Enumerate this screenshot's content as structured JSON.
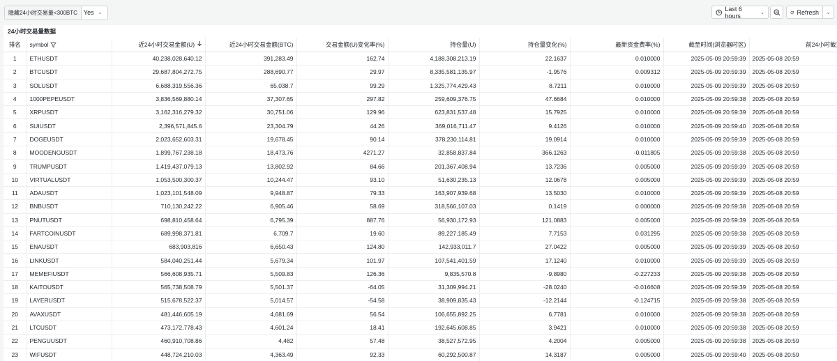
{
  "toolbar": {
    "filter_label": "隐藏24小时交易量<300BTC",
    "filter_value": "Yes",
    "time_range": "Last 6 hours",
    "refresh_label": "Refresh"
  },
  "panel": {
    "title": "24小时交易量数据",
    "columns": [
      "排名",
      "symbol",
      "近24小时交易金额(U)",
      "近24小时交易金额(BTC)",
      "交易金额(U)变化率(%)",
      "持仓量(U)",
      "持仓量变化(%)",
      "最新资金费率(%)",
      "截至时间(浏览器时区)",
      "前24小时截至时间(浏览器时"
    ],
    "rows": [
      [
        "1",
        "ETHUSDT",
        "40,238,028,640.12",
        "391,283.49",
        "162.74",
        "4,188,308,213.19",
        "22.1637",
        "0.010000",
        "2025-05-09 20:59:39",
        "2025-05-08 20:59"
      ],
      [
        "2",
        "BTCUSDT",
        "29,687,804,272.75",
        "288,690.77",
        "29.97",
        "8,335,581,135.97",
        "-1.9576",
        "0.009312",
        "2025-05-09 20:59:39",
        "2025-05-08 20:59"
      ],
      [
        "3",
        "SOLUSDT",
        "6,688,319,556.36",
        "65,038.7",
        "99.29",
        "1,325,774,429.43",
        "8.7211",
        "0.010000",
        "2025-05-09 20:59:39",
        "2025-05-08 20:59"
      ],
      [
        "4",
        "1000PEPEUSDT",
        "3,836,569,880.14",
        "37,307.65",
        "297.82",
        "259,609,376.75",
        "47.6684",
        "0.010000",
        "2025-05-09 20:59:38",
        "2025-05-08 20:59"
      ],
      [
        "5",
        "XRPUSDT",
        "3,162,316,279.32",
        "30,751.06",
        "129.96",
        "623,831,537.48",
        "15.7925",
        "0.010000",
        "2025-05-09 20:59:39",
        "2025-05-08 20:59"
      ],
      [
        "6",
        "SUIUSDT",
        "2,396,571,845.6",
        "23,304.79",
        "44.26",
        "369,016,711.47",
        "9.4126",
        "0.010000",
        "2025-05-09 20:59:40",
        "2025-05-08 20:59"
      ],
      [
        "7",
        "DOGEUSDT",
        "2,023,652,603.31",
        "19,678.45",
        "90.14",
        "378,230,114.81",
        "19.0914",
        "0.010000",
        "2025-05-09 20:59:39",
        "2025-05-08 20:59"
      ],
      [
        "8",
        "MOODENGUSDT",
        "1,899,767,238.18",
        "18,473.76",
        "4271.27",
        "32,858,837.84",
        "366.1263",
        "-0.011805",
        "2025-05-09 20:59:38",
        "2025-05-08 20:59"
      ],
      [
        "9",
        "TRUMPUSDT",
        "1,419,437,079.13",
        "13,802.92",
        "84.66",
        "201,367,408.94",
        "13.7236",
        "0.005000",
        "2025-05-09 20:59:39",
        "2025-05-08 20:59"
      ],
      [
        "10",
        "VIRTUALUSDT",
        "1,053,500,300.37",
        "10,244.47",
        "93.10",
        "51,630,235.13",
        "12.0678",
        "0.005000",
        "2025-05-09 20:59:39",
        "2025-05-08 20:59"
      ],
      [
        "11",
        "ADAUSDT",
        "1,023,101,548.09",
        "9,948.87",
        "79.33",
        "163,907,939.68",
        "13.5030",
        "0.010000",
        "2025-05-09 20:59:39",
        "2025-05-08 20:59"
      ],
      [
        "12",
        "BNBUSDT",
        "710,130,242.22",
        "6,905.46",
        "58.69",
        "318,566,107.03",
        "0.1419",
        "0.000000",
        "2025-05-09 20:59:38",
        "2025-05-08 20:59"
      ],
      [
        "13",
        "PNUTUSDT",
        "698,810,458.64",
        "6,795.39",
        "887.76",
        "56,930,172.93",
        "121.0883",
        "0.005000",
        "2025-05-09 20:59:39",
        "2025-05-08 20:59"
      ],
      [
        "14",
        "FARTCOINUSDT",
        "689,998,371.81",
        "6,709.7",
        "19.60",
        "89,227,185.49",
        "7.7153",
        "0.031295",
        "2025-05-09 20:59:38",
        "2025-05-08 20:59"
      ],
      [
        "15",
        "ENAUSDT",
        "683,903,816",
        "6,650.43",
        "124.80",
        "142,933,011.7",
        "27.0422",
        "0.005000",
        "2025-05-09 20:59:39",
        "2025-05-08 20:59"
      ],
      [
        "16",
        "LINKUSDT",
        "584,040,251.44",
        "5,679.34",
        "101.97",
        "107,541,401.59",
        "17.1240",
        "0.010000",
        "2025-05-09 20:59:39",
        "2025-05-08 20:59"
      ],
      [
        "17",
        "MEMEFIUSDT",
        "566,608,935.71",
        "5,509.83",
        "126.36",
        "9,835,570.8",
        "-9.8980",
        "-0.227233",
        "2025-05-09 20:59:38",
        "2025-05-08 20:59"
      ],
      [
        "18",
        "KAITOUSDT",
        "565,738,508.79",
        "5,501.37",
        "-64.05",
        "31,309,994.21",
        "-28.0240",
        "-0.016608",
        "2025-05-09 20:59:39",
        "2025-05-08 20:59"
      ],
      [
        "19",
        "LAYERUSDT",
        "515,678,522.37",
        "5,014.57",
        "-54.58",
        "38,909,835.43",
        "-12.2144",
        "-0.124715",
        "2025-05-09 20:59:38",
        "2025-05-08 20:59"
      ],
      [
        "20",
        "AVAXUSDT",
        "481,446,605.19",
        "4,681.69",
        "56.54",
        "106,655,892.25",
        "6.7781",
        "0.010000",
        "2025-05-09 20:59:38",
        "2025-05-08 20:59"
      ],
      [
        "21",
        "LTCUSDT",
        "473,172,778.43",
        "4,601.24",
        "18.41",
        "192,645,608.85",
        "3.9421",
        "0.010000",
        "2025-05-09 20:59:38",
        "2025-05-08 20:59"
      ],
      [
        "22",
        "PENGUUSDT",
        "460,910,708.86",
        "4,482",
        "57.48",
        "38,527,572.95",
        "4.2004",
        "0.005000",
        "2025-05-09 20:59:38",
        "2025-05-08 20:59"
      ],
      [
        "23",
        "WIFUSDT",
        "448,724,210.03",
        "4,363.49",
        "92.33",
        "60,292,500.87",
        "14.3187",
        "0.005000",
        "2025-05-09 20:59:40",
        "2025-05-08 20:59"
      ]
    ]
  },
  "icons": {
    "sort": "arrow-down-icon",
    "filter": "funnel-icon",
    "clock": "clock-icon",
    "zoom": "zoom-out-icon",
    "refresh": "refresh-icon"
  }
}
